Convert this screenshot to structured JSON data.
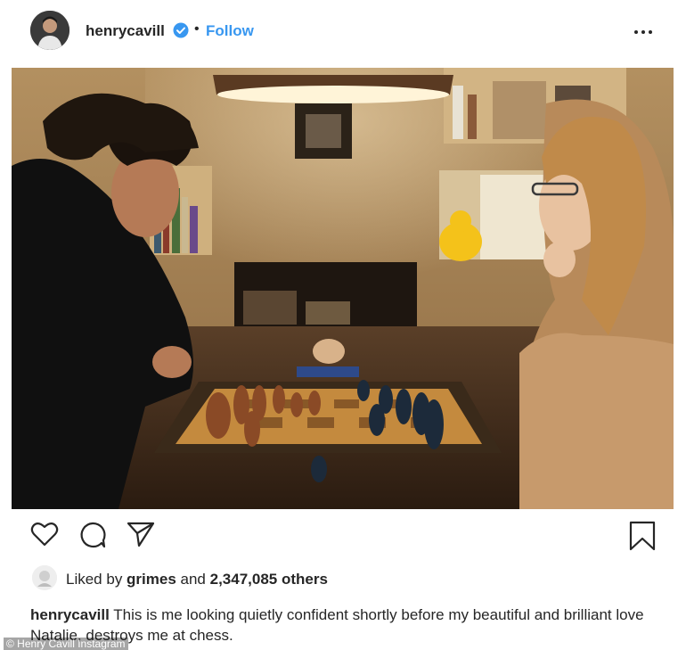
{
  "post": {
    "username": "henrycavill",
    "dot": "•",
    "follow_label": "Follow",
    "more_icon": "more-horizontal-icon"
  },
  "actions": {
    "like_icon": "heart-icon",
    "comment_icon": "comment-icon",
    "share_icon": "send-icon",
    "save_icon": "bookmark-icon"
  },
  "likes": {
    "prefix": "Liked by ",
    "user": "grimes",
    "middle": " and ",
    "count": "2,347,085 others"
  },
  "caption": {
    "username": "henrycavill",
    "text": " This is me looking quietly confident shortly before my beautiful and brilliant love Natalie, destroys me at chess."
  },
  "watermark": "© Henry Cavill Instagram",
  "colors": {
    "follow": "#3897f0",
    "verified": "#3897f0",
    "text": "#262626"
  }
}
